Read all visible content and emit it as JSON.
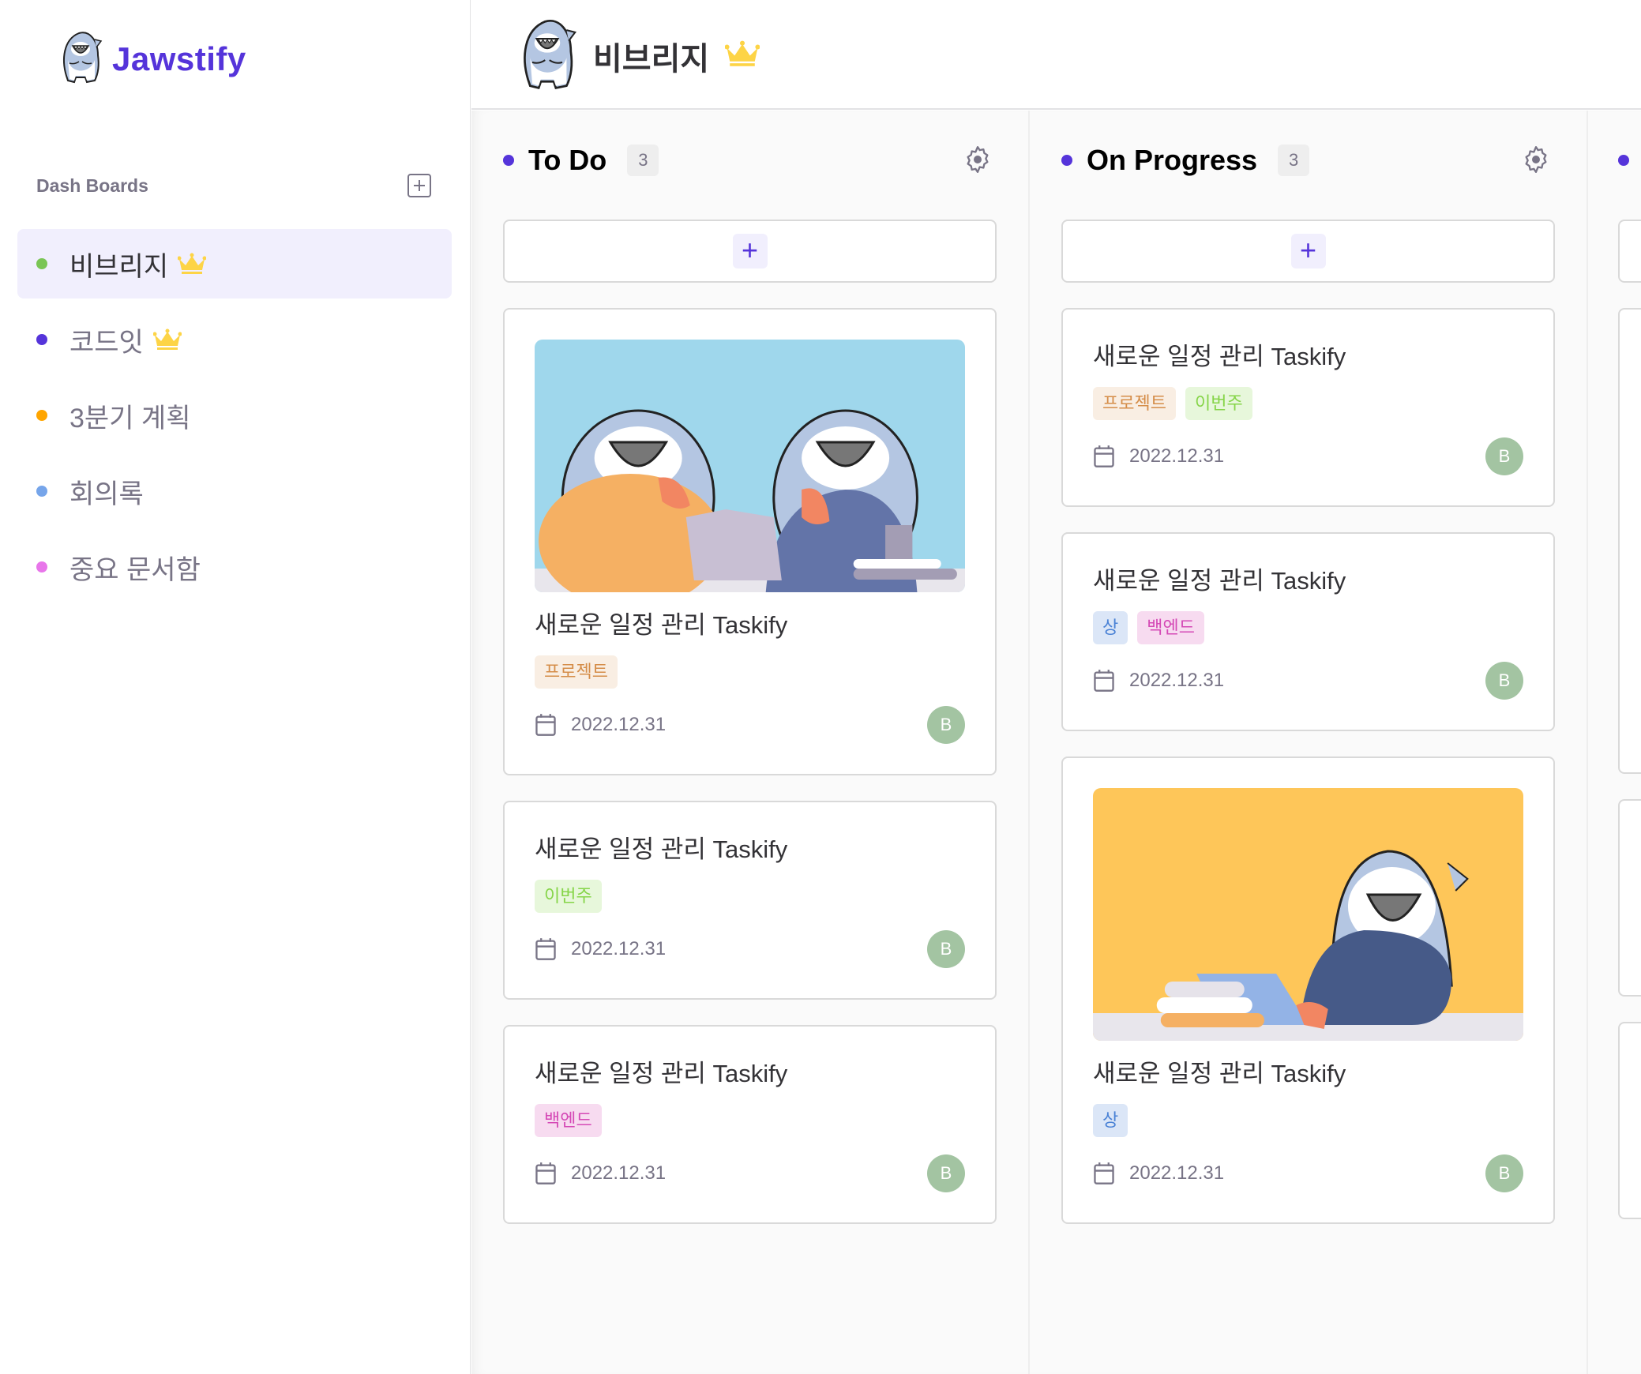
{
  "app": {
    "name": "Jawstify",
    "logo_icon": "shark-mascot-icon"
  },
  "sidebar": {
    "section_title": "Dash Boards",
    "add_icon": "plus-square-icon",
    "boards": [
      {
        "name": "비브리지",
        "color": "#7ac555",
        "owner_crown": true,
        "active": true
      },
      {
        "name": "코드잇",
        "color": "#5534da",
        "owner_crown": true,
        "active": false
      },
      {
        "name": "3분기 계획",
        "color": "#ffa500",
        "owner_crown": false,
        "active": false
      },
      {
        "name": "회의록",
        "color": "#76a5ea",
        "owner_crown": false,
        "active": false
      },
      {
        "name": "중요 문서함",
        "color": "#e876ea",
        "owner_crown": false,
        "active": false
      }
    ]
  },
  "header": {
    "title": "비브리지",
    "crown": true
  },
  "colors": {
    "accent": "#5534da",
    "tag_project_bg": "#f9eee3",
    "tag_project_fg": "#d58d49",
    "tag_week_bg": "#e7f7db",
    "tag_week_fg": "#86d549",
    "tag_backend_bg": "#f7dbf0",
    "tag_backend_fg": "#d549b6",
    "tag_high_bg": "#dbe6f7",
    "tag_high_fg": "#4981d5",
    "avatar_bg": "#a3c4a2"
  },
  "columns": [
    {
      "title": "To Do",
      "count": "3",
      "cards": [
        {
          "image": "two-sharks-reading",
          "title": "새로운 일정 관리 Taskify",
          "tags": [
            "프로젝트"
          ],
          "date": "2022.12.31",
          "assignee": "B"
        },
        {
          "image": null,
          "title": "새로운 일정 관리 Taskify",
          "tags": [
            "이번주"
          ],
          "date": "2022.12.31",
          "assignee": "B"
        },
        {
          "image": null,
          "title": "새로운 일정 관리 Taskify",
          "tags": [
            "백엔드"
          ],
          "date": "2022.12.31",
          "assignee": "B"
        }
      ]
    },
    {
      "title": "On Progress",
      "count": "3",
      "cards": [
        {
          "image": null,
          "title": "새로운 일정 관리 Taskify",
          "tags": [
            "프로젝트",
            "이번주"
          ],
          "date": "2022.12.31",
          "assignee": "B"
        },
        {
          "image": null,
          "title": "새로운 일정 관리 Taskify",
          "tags": [
            "상",
            "백엔드"
          ],
          "date": "2022.12.31",
          "assignee": "B"
        },
        {
          "image": "shark-on-laptop",
          "title": "새로운 일정 관리 Taskify",
          "tags": [
            "상"
          ],
          "date": "2022.12.31",
          "assignee": "B"
        }
      ]
    }
  ],
  "add_card_label": "+"
}
